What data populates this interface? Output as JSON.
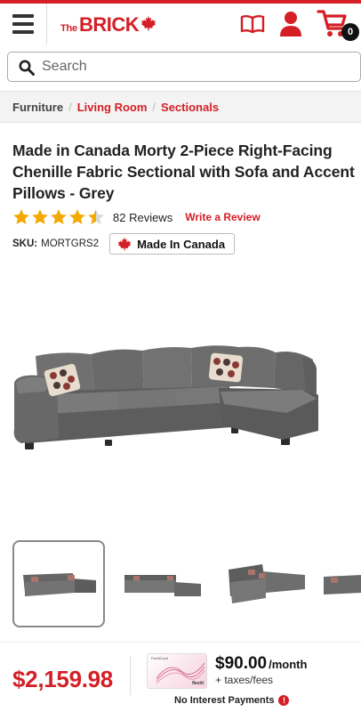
{
  "header": {
    "logo_small": "The",
    "logo_main": "BRICK",
    "cart_count": "0",
    "accent_color": "#d41f26",
    "icons": [
      "menu-icon",
      "catalogue-icon",
      "account-icon",
      "cart-icon"
    ]
  },
  "search": {
    "placeholder": "Search"
  },
  "breadcrumb": {
    "items": [
      "Furniture",
      "Living Room",
      "Sectionals"
    ]
  },
  "product": {
    "title": "Made in Canada Morty 2-Piece Right-Facing Chenille Fabric Sectional with Sofa and Accent Pillows - Grey",
    "rating": 4.5,
    "rating_max": 5,
    "reviews_text": "82 Reviews",
    "write_review": "Write a Review",
    "sku_label": "SKU:",
    "sku_value": "MORTGRS2",
    "made_in_label": "Made In Canada"
  },
  "gallery": {
    "thumbnail_count": 4,
    "selected_index": 0
  },
  "pricing": {
    "price": "$2,159.98",
    "monthly_amount": "$90.00",
    "monthly_unit": "/month",
    "taxes": "+ taxes/fees",
    "no_interest": "No Interest Payments",
    "card_name": "FlexitiCard",
    "card_brand": "flexiti"
  }
}
